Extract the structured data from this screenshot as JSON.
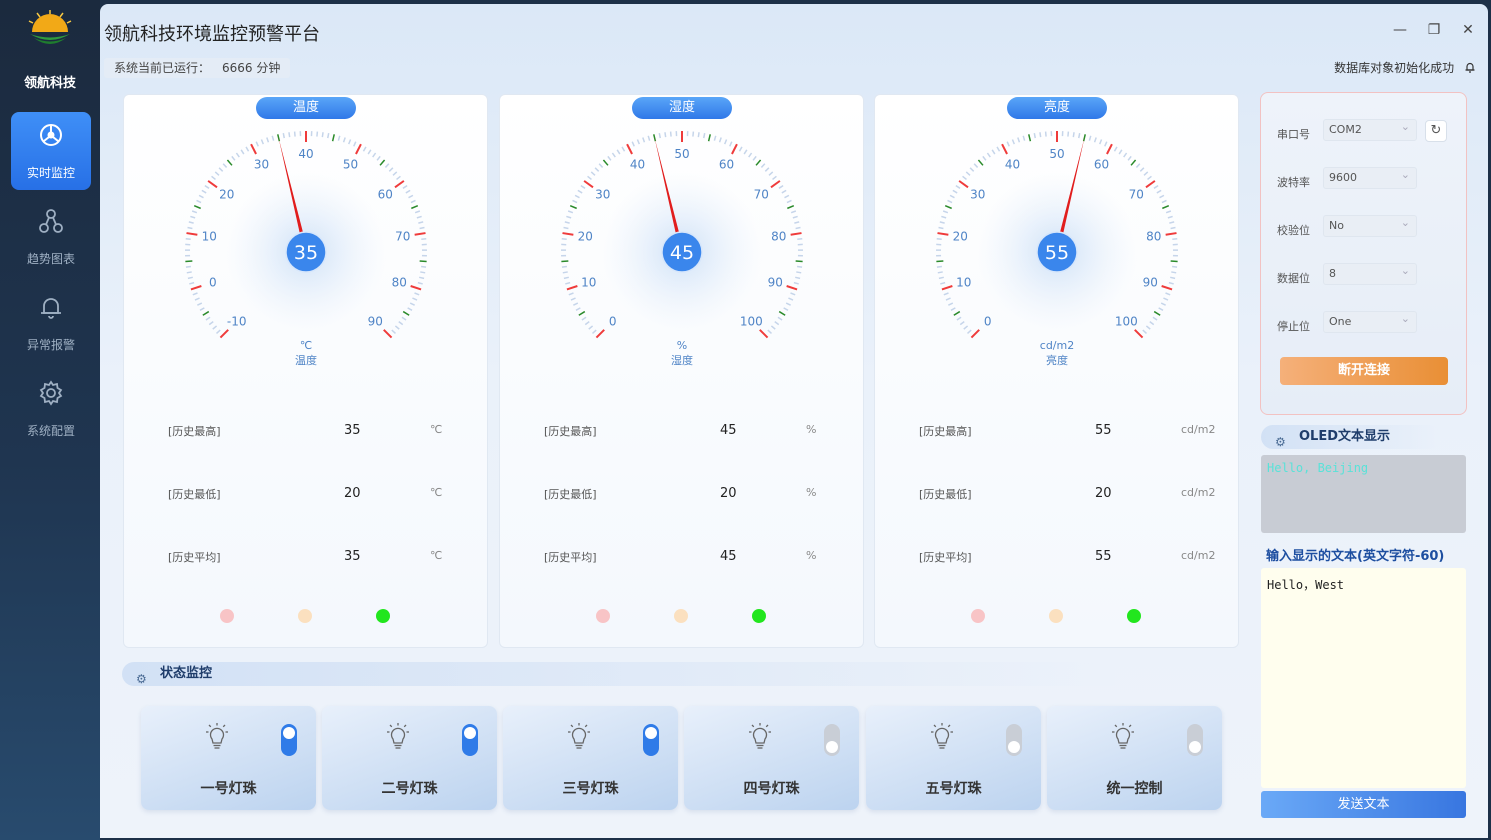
{
  "sidebar": {
    "brand": "领航科技",
    "items": [
      {
        "label": "实时监控",
        "icon": "dashboard-icon",
        "active": true
      },
      {
        "label": "趋势图表",
        "icon": "trend-icon",
        "active": false
      },
      {
        "label": "异常报警",
        "icon": "bell-icon",
        "active": false
      },
      {
        "label": "系统配置",
        "icon": "gear-icon",
        "active": false
      }
    ]
  },
  "window": {
    "title": "领航科技环境监控预警平台",
    "minimize": "—",
    "restore": "❐",
    "close": "✕"
  },
  "statusbar": {
    "runtime_label": "系统当前已运行：",
    "runtime_value": "6666 分钟",
    "db_status": "数据库对象初始化成功"
  },
  "gauges": [
    {
      "pill": "温度",
      "value": 35,
      "display": "35",
      "min": -10,
      "max": 90,
      "ticks": [
        "-10",
        "0",
        "10",
        "20",
        "30",
        "40",
        "50",
        "60",
        "70",
        "80",
        "90"
      ],
      "unit": "℃",
      "caption": "温度",
      "stats": [
        {
          "label": "[历史最高]",
          "value": "35",
          "unit": "℃"
        },
        {
          "label": "[历史最低]",
          "value": "20",
          "unit": "℃"
        },
        {
          "label": "[历史平均]",
          "value": "35",
          "unit": "℃"
        }
      ]
    },
    {
      "pill": "湿度",
      "value": 45,
      "display": "45",
      "min": 0,
      "max": 100,
      "ticks": [
        "0",
        "10",
        "20",
        "30",
        "40",
        "50",
        "60",
        "70",
        "80",
        "90",
        "100"
      ],
      "unit": "%",
      "caption": "湿度",
      "stats": [
        {
          "label": "[历史最高]",
          "value": "45",
          "unit": "%"
        },
        {
          "label": "[历史最低]",
          "value": "20",
          "unit": "%"
        },
        {
          "label": "[历史平均]",
          "value": "45",
          "unit": "%"
        }
      ]
    },
    {
      "pill": "亮度",
      "value": 55,
      "display": "55",
      "min": 0,
      "max": 100,
      "ticks": [
        "0",
        "10",
        "20",
        "30",
        "40",
        "50",
        "60",
        "70",
        "80",
        "90",
        "100"
      ],
      "unit": "cd/m2",
      "caption": "亮度",
      "stats": [
        {
          "label": "[历史最高]",
          "value": "55",
          "unit": "cd/m2"
        },
        {
          "label": "[历史最低]",
          "value": "20",
          "unit": "cd/m2"
        },
        {
          "label": "[历史平均]",
          "value": "55",
          "unit": "cd/m2"
        }
      ]
    }
  ],
  "indicator_colors": [
    "#f8c4c6",
    "#fbe0bf",
    "#22e61e"
  ],
  "status_section": {
    "icon": "settings-icon",
    "title": "状态监控"
  },
  "lamps": [
    {
      "name": "一号灯珠",
      "on": true
    },
    {
      "name": "二号灯珠",
      "on": true
    },
    {
      "name": "三号灯珠",
      "on": true
    },
    {
      "name": "四号灯珠",
      "on": false
    },
    {
      "name": "五号灯珠",
      "on": false
    },
    {
      "name": "统一控制",
      "on": false
    }
  ],
  "serial": {
    "port_label": "串口号",
    "port_value": "COM2",
    "baud_label": "波特率",
    "baud_value": "9600",
    "parity_label": "校验位",
    "parity_value": "No",
    "databits_label": "数据位",
    "databits_value": "8",
    "stopbits_label": "停止位",
    "stopbits_value": "One",
    "refresh_icon": "refresh-icon",
    "connect_button": "断开连接"
  },
  "oled": {
    "section_title": "OLED文本显示",
    "display_text": "Hello, Beijing",
    "input_label": "输入显示的文本(英文字符-60)",
    "input_value": "Hello，West",
    "send_button": "发送文本"
  },
  "colors": {
    "accent": "#2f78e8",
    "needle": "#e11d1d",
    "connect": "#e98f35"
  }
}
